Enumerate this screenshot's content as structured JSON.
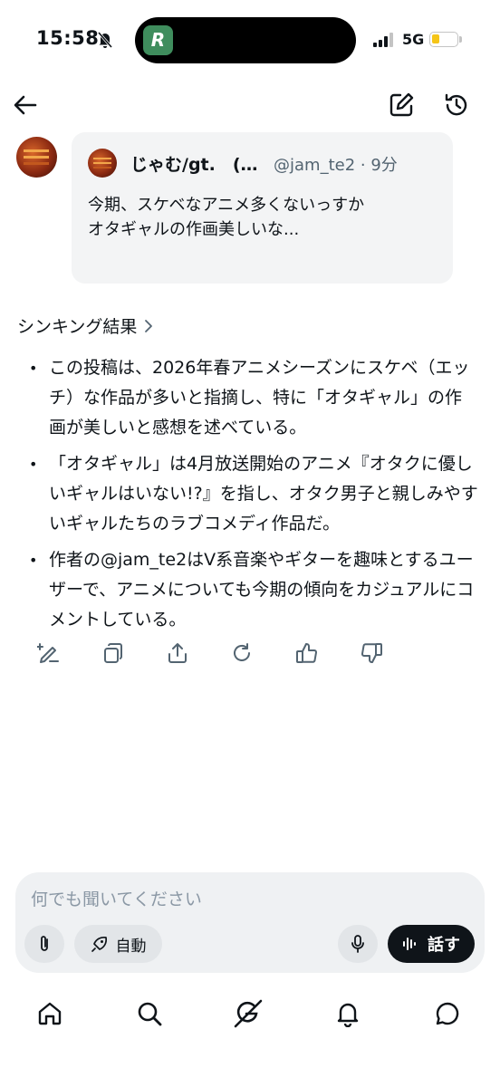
{
  "status_bar": {
    "time": "15:58",
    "network": "5G",
    "app_badge": "R",
    "battery_level": 0.3
  },
  "header": {
    "back_icon": "arrow-left-icon",
    "compose_icon": "compose-icon",
    "history_icon": "history-icon"
  },
  "quoted_post": {
    "author_name": "じゃむ/gt.　(…",
    "meta": "@jam_te2 · 9分",
    "text": "今期、スケベなアニメ多くないっすか\nオタギャルの作画美しいな..."
  },
  "response": {
    "thinking_label": "シンキング結果",
    "bullets": [
      "この投稿は、2026年春アニメシーズンにスケベ（エッチ）な作品が多いと指摘し、特に「オタギャル」の作画が美しいと感想を述べている。",
      "「オタギャル」は4月放送開始のアニメ『オタクに優しいギャルはいない!?』を指し、オタク男子と親しみやすいギャルたちのラブコメディ作品だ。",
      "作者の@jam_te2はV系音楽やギターを趣味とするユーザーで、アニメについても今期の傾向をカジュアルにコメントしている。"
    ]
  },
  "actions": [
    "edit-icon",
    "copy-icon",
    "share-icon",
    "regenerate-icon",
    "thumbs-up-icon",
    "thumbs-down-icon"
  ],
  "composer": {
    "placeholder": "何でも聞いてください",
    "value": "",
    "mode_label": "自動",
    "speak_label": "話す"
  },
  "bottom_nav": [
    "home-icon",
    "search-icon",
    "grok-icon",
    "notifications-icon",
    "messages-icon"
  ],
  "colors": {
    "card_bg": "#f3f4f5",
    "composer_bg": "#eff1f3",
    "speak_bg": "#0f1419",
    "app_badge": "#3f8d5d",
    "battery": "#f5c518"
  }
}
